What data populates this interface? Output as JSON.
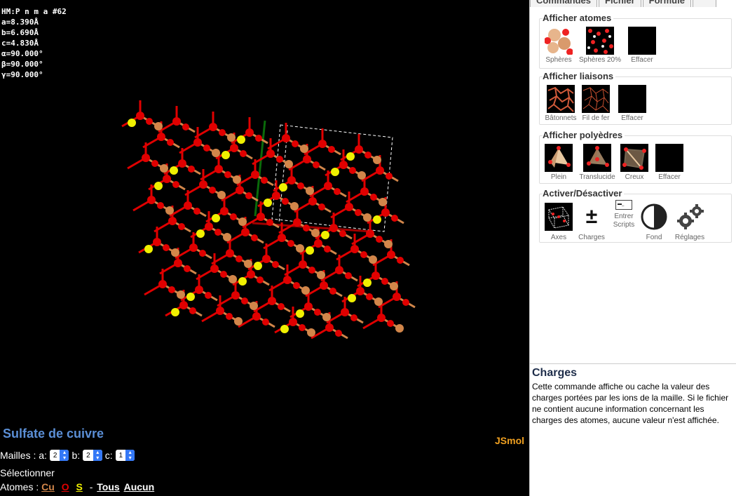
{
  "cell_info": {
    "lines": [
      "HM:P n m a #62",
      "a=8.390Å",
      "b=6.690Å",
      "c=4.830Å",
      "α=90.000°",
      "β=90.000°",
      "γ=90.000°"
    ]
  },
  "jsmol_label": "JSmol",
  "bottom": {
    "title": "Sulfate de cuivre",
    "mailles_label": "Mailles : a:",
    "a_value": "2",
    "b_label": "b:",
    "b_value": "2",
    "c_label": "c:",
    "c_value": "1",
    "select_label": "Sélectionner",
    "atoms_label": "Atomes :",
    "atom_cu": "Cu",
    "atom_o": "O",
    "atom_s": "S",
    "dash": "-",
    "all": "Tous",
    "none": "Aucun"
  },
  "colors": {
    "cu": "#d2864a",
    "o": "#e00000",
    "s": "#f0f000",
    "accent_blue": "#5b8fd6",
    "jsmol": "#f0a020"
  },
  "tabs": [
    "Commandes",
    "Fichier",
    "Formule"
  ],
  "groups": {
    "atoms": {
      "title": "Afficher atomes",
      "items": [
        "Sphères",
        "Sphères 20%",
        "Effacer"
      ]
    },
    "bonds": {
      "title": "Afficher liaisons",
      "items": [
        "Bâtonnets",
        "Fil de fer",
        "Effacer"
      ]
    },
    "polyhedra": {
      "title": "Afficher polyèdres",
      "items": [
        "Plein",
        "Translucide",
        "Creux",
        "Effacer"
      ]
    },
    "toggle": {
      "title": "Activer/Désactiver",
      "items": [
        "Axes",
        "Charges",
        "Entrer Scripts",
        "Fond",
        "Réglages"
      ]
    }
  },
  "help": {
    "title": "Charges",
    "text": "Cette commande affiche ou cache la valeur des charges portées par les ions de la maille. Si le fichier ne contient aucune information concernant les charges des atomes, aucune valeur n'est affichée."
  }
}
